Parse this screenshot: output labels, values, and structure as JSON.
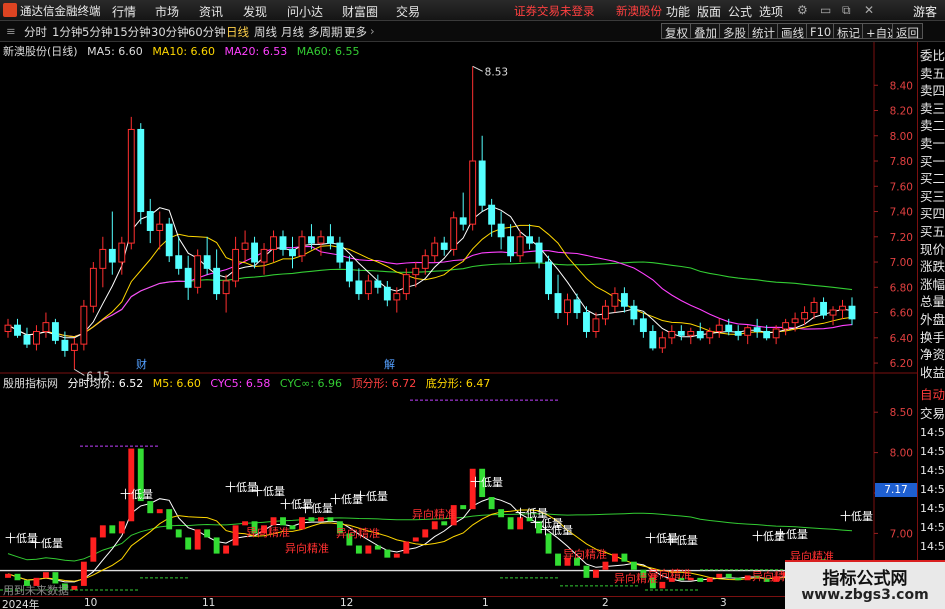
{
  "app": {
    "title": "通达信金融终端"
  },
  "menu": [
    "行情",
    "市场",
    "资讯",
    "发现",
    "问小达",
    "财富圈",
    "交易"
  ],
  "status": {
    "trade_login": "证券交易未登录",
    "stock_name": "新澳股份"
  },
  "right_menu": [
    "功能",
    "版面",
    "公式",
    "选项"
  ],
  "guest": "游客",
  "periods": [
    "分时",
    "1分钟",
    "5分钟",
    "15分钟",
    "30分钟",
    "60分钟",
    "日线",
    "周线",
    "月线",
    "多周期",
    "更多"
  ],
  "active_period": "日线",
  "tools": [
    "复权",
    "叠加",
    "多股",
    "统计",
    "画线",
    "F10",
    "标记",
    "+自选",
    "返回"
  ],
  "main_legend": {
    "title": "新澳股份(日线)",
    "ma5": "MA5: 6.60",
    "ma10": "MA10: 6.60",
    "ma20": "MA20: 6.53",
    "ma60": "MA60: 6.55"
  },
  "indicator_legend": {
    "title": "殷朋指标网",
    "avg": "分时均价: 6.52",
    "m5": "M5: 6.60",
    "cyc5": "CYC5: 6.58",
    "cycinf": "CYC∞: 6.96",
    "top": "顶分形: 6.72",
    "bottom": "底分形: 6.47"
  },
  "price_axis_main": [
    "8.40",
    "8.20",
    "8.00",
    "7.80",
    "7.60",
    "7.40",
    "7.20",
    "7.00",
    "6.80",
    "6.60",
    "6.40",
    "6.20"
  ],
  "price_axis_sub": [
    "8.50",
    "8.00",
    "7.50",
    "7.00",
    "6.50"
  ],
  "current_price_label": "7.17",
  "annotations": {
    "high": "8.53",
    "low": "6.15",
    "cai": "财",
    "jie": "解",
    "dilian": "十低量",
    "yixiang": "异向精准"
  },
  "side_tabs_top": [
    "委比",
    "卖五",
    "卖四",
    "卖三",
    "卖二",
    "卖一",
    "买一",
    "买二",
    "买三",
    "买四",
    "买五",
    "现价",
    "涨跌",
    "涨幅",
    "总量",
    "外盘",
    "换手",
    "净资",
    "收益"
  ],
  "side_tabs_bottom": [
    "自动",
    "交易",
    "14:56",
    "14:56",
    "14:56",
    "14:56",
    "14:56",
    "14:56",
    "14:56"
  ],
  "dates": [
    "2024年",
    "10",
    "11",
    "12",
    "1",
    "2",
    "3"
  ],
  "footnote": "用到未来数据",
  "watermark": {
    "title": "指标公式网",
    "url": "www.zbgs3.com"
  },
  "colors": {
    "up": "#ff3030",
    "down": "#54ffff",
    "ma5": "#ffffff",
    "ma10": "#ffd700",
    "ma20": "#ff40ff",
    "ma60": "#33cc33"
  },
  "chart_data": {
    "type": "candlestick",
    "y_range": [
      6.05,
      8.6
    ],
    "candles": [
      [
        6.45,
        6.55,
        6.4,
        6.5
      ],
      [
        6.5,
        6.55,
        6.4,
        6.42
      ],
      [
        6.42,
        6.48,
        6.32,
        6.35
      ],
      [
        6.35,
        6.5,
        6.3,
        6.45
      ],
      [
        6.45,
        6.6,
        6.4,
        6.52
      ],
      [
        6.52,
        6.55,
        6.35,
        6.38
      ],
      [
        6.38,
        6.45,
        6.25,
        6.3
      ],
      [
        6.3,
        6.4,
        6.15,
        6.35
      ],
      [
        6.35,
        6.7,
        6.3,
        6.65
      ],
      [
        6.65,
        7.0,
        6.6,
        6.95
      ],
      [
        6.95,
        7.2,
        6.8,
        7.1
      ],
      [
        7.1,
        7.4,
        6.9,
        7.0
      ],
      [
        7.0,
        7.2,
        6.9,
        7.15
      ],
      [
        7.15,
        8.15,
        7.1,
        8.05
      ],
      [
        8.05,
        8.1,
        7.3,
        7.4
      ],
      [
        7.4,
        7.5,
        7.15,
        7.25
      ],
      [
        7.25,
        7.4,
        7.1,
        7.3
      ],
      [
        7.3,
        7.35,
        7.0,
        7.05
      ],
      [
        7.05,
        7.2,
        6.9,
        6.95
      ],
      [
        6.95,
        7.05,
        6.7,
        6.8
      ],
      [
        6.8,
        7.1,
        6.75,
        7.05
      ],
      [
        7.05,
        7.2,
        6.9,
        6.95
      ],
      [
        6.95,
        7.1,
        6.7,
        6.75
      ],
      [
        6.75,
        6.9,
        6.6,
        6.85
      ],
      [
        6.85,
        7.2,
        6.8,
        7.1
      ],
      [
        7.1,
        7.25,
        7.0,
        7.15
      ],
      [
        7.15,
        7.2,
        6.95,
        7.0
      ],
      [
        7.0,
        7.15,
        6.9,
        7.1
      ],
      [
        7.1,
        7.25,
        7.0,
        7.2
      ],
      [
        7.2,
        7.25,
        7.05,
        7.1
      ],
      [
        7.1,
        7.2,
        6.95,
        7.05
      ],
      [
        7.05,
        7.25,
        7.0,
        7.2
      ],
      [
        7.2,
        7.3,
        7.1,
        7.15
      ],
      [
        7.15,
        7.25,
        7.05,
        7.2
      ],
      [
        7.2,
        7.3,
        7.1,
        7.15
      ],
      [
        7.15,
        7.2,
        6.95,
        7.0
      ],
      [
        7.0,
        7.05,
        6.8,
        6.85
      ],
      [
        6.85,
        6.95,
        6.7,
        6.75
      ],
      [
        6.75,
        6.9,
        6.7,
        6.85
      ],
      [
        6.85,
        6.9,
        6.75,
        6.8
      ],
      [
        6.8,
        6.85,
        6.65,
        6.7
      ],
      [
        6.7,
        6.8,
        6.6,
        6.75
      ],
      [
        6.75,
        6.95,
        6.7,
        6.9
      ],
      [
        6.9,
        7.0,
        6.8,
        6.95
      ],
      [
        6.95,
        7.1,
        6.9,
        7.05
      ],
      [
        7.05,
        7.2,
        7.0,
        7.15
      ],
      [
        7.15,
        7.2,
        7.05,
        7.1
      ],
      [
        7.1,
        7.4,
        7.05,
        7.35
      ],
      [
        7.35,
        7.55,
        7.25,
        7.3
      ],
      [
        7.3,
        8.55,
        7.25,
        7.8
      ],
      [
        7.8,
        8.0,
        7.4,
        7.45
      ],
      [
        7.45,
        7.5,
        7.2,
        7.3
      ],
      [
        7.3,
        7.4,
        7.1,
        7.2
      ],
      [
        7.2,
        7.3,
        7.0,
        7.05
      ],
      [
        7.05,
        7.25,
        7.0,
        7.2
      ],
      [
        7.2,
        7.3,
        7.1,
        7.15
      ],
      [
        7.15,
        7.2,
        6.95,
        7.0
      ],
      [
        7.0,
        7.05,
        6.7,
        6.75
      ],
      [
        6.75,
        6.9,
        6.55,
        6.6
      ],
      [
        6.6,
        6.75,
        6.5,
        6.7
      ],
      [
        6.7,
        6.75,
        6.55,
        6.6
      ],
      [
        6.6,
        6.65,
        6.4,
        6.45
      ],
      [
        6.45,
        6.6,
        6.4,
        6.55
      ],
      [
        6.55,
        6.7,
        6.5,
        6.65
      ],
      [
        6.65,
        6.8,
        6.6,
        6.75
      ],
      [
        6.75,
        6.8,
        6.6,
        6.65
      ],
      [
        6.65,
        6.7,
        6.5,
        6.55
      ],
      [
        6.55,
        6.6,
        6.4,
        6.45
      ],
      [
        6.45,
        6.5,
        6.3,
        6.32
      ],
      [
        6.32,
        6.45,
        6.28,
        6.4
      ],
      [
        6.4,
        6.5,
        6.35,
        6.45
      ],
      [
        6.45,
        6.5,
        6.38,
        6.42
      ],
      [
        6.42,
        6.48,
        6.35,
        6.45
      ],
      [
        6.45,
        6.52,
        6.38,
        6.4
      ],
      [
        6.4,
        6.48,
        6.35,
        6.45
      ],
      [
        6.45,
        6.55,
        6.4,
        6.5
      ],
      [
        6.5,
        6.55,
        6.42,
        6.45
      ],
      [
        6.45,
        6.5,
        6.38,
        6.42
      ],
      [
        6.42,
        6.5,
        6.35,
        6.48
      ],
      [
        6.48,
        6.55,
        6.4,
        6.45
      ],
      [
        6.45,
        6.5,
        6.38,
        6.4
      ],
      [
        6.4,
        6.5,
        6.35,
        6.47
      ],
      [
        6.47,
        6.55,
        6.42,
        6.52
      ],
      [
        6.52,
        6.6,
        6.45,
        6.55
      ],
      [
        6.55,
        6.65,
        6.5,
        6.6
      ],
      [
        6.6,
        6.72,
        6.55,
        6.68
      ],
      [
        6.68,
        6.72,
        6.55,
        6.58
      ],
      [
        6.58,
        6.65,
        6.5,
        6.62
      ],
      [
        6.62,
        6.7,
        6.55,
        6.65
      ],
      [
        6.65,
        6.72,
        6.5,
        6.55
      ]
    ],
    "ma60_level_hint": [
      6.7,
      6.55
    ]
  }
}
